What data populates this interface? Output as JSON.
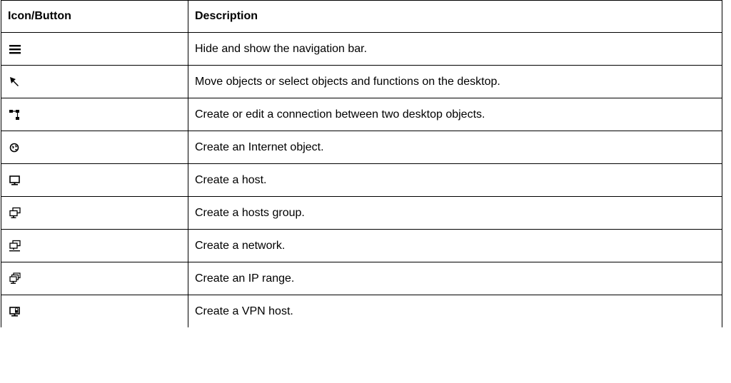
{
  "table": {
    "headers": [
      "Icon/Button",
      "Description"
    ],
    "rows": [
      {
        "icon": "hamburger-menu-icon",
        "description": "Hide and show the navigation bar."
      },
      {
        "icon": "pointer-arrow-icon",
        "description": "Move objects or select objects and functions on the desktop."
      },
      {
        "icon": "connection-icon",
        "description": "Create or edit a connection between two desktop objects."
      },
      {
        "icon": "internet-globe-icon",
        "description": "Create an Internet object."
      },
      {
        "icon": "host-icon",
        "description": "Create a host."
      },
      {
        "icon": "hosts-group-icon",
        "description": "Create a hosts group."
      },
      {
        "icon": "network-icon",
        "description": "Create a network."
      },
      {
        "icon": "ip-range-icon",
        "description": "Create an IP range."
      },
      {
        "icon": "vpn-host-icon",
        "description": "Create a VPN host."
      }
    ]
  }
}
